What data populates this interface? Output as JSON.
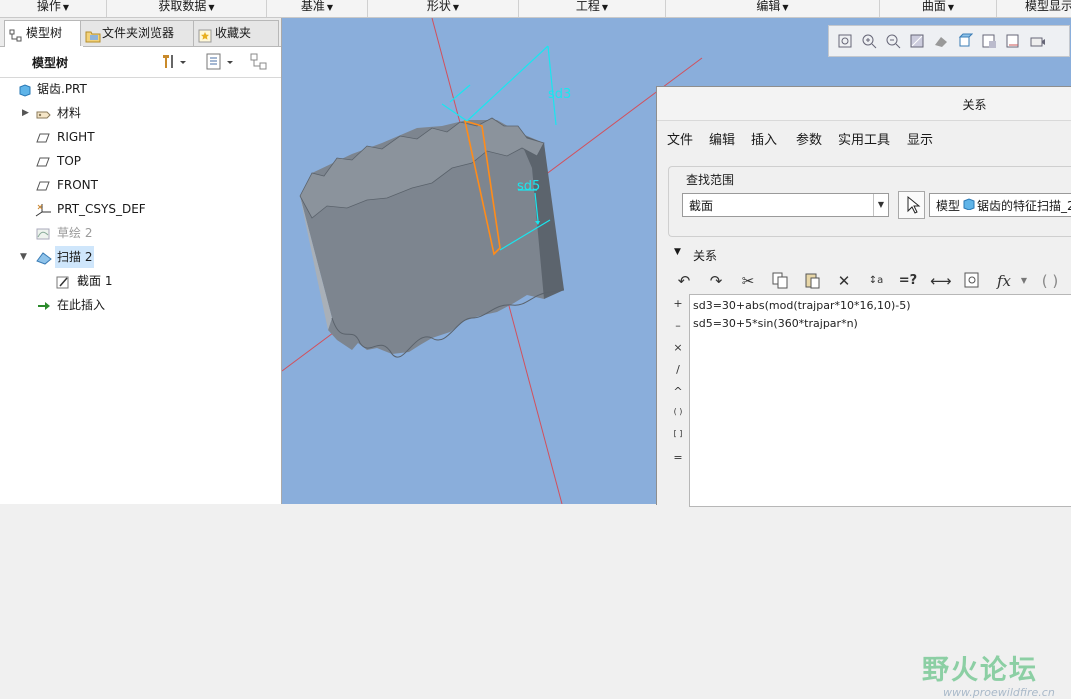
{
  "ribbon": {
    "groups": [
      "操作",
      "获取数据",
      "基准",
      "形状",
      "工程",
      "编辑",
      "曲面",
      "模型显示"
    ]
  },
  "left_panel": {
    "tabs": [
      "模型树",
      "文件夹浏览器",
      "收藏夹"
    ],
    "tree_title": "模型树",
    "items": [
      {
        "label": "锯齿.PRT",
        "icon": "part-icon"
      },
      {
        "label": "材料",
        "icon": "material-icon"
      },
      {
        "label": "RIGHT",
        "icon": "datum-plane-icon"
      },
      {
        "label": "TOP",
        "icon": "datum-plane-icon"
      },
      {
        "label": "FRONT",
        "icon": "datum-plane-icon"
      },
      {
        "label": "PRT_CSYS_DEF",
        "icon": "csys-icon"
      },
      {
        "label": "草绘 2",
        "icon": "sketch-icon"
      },
      {
        "label": "扫描 2",
        "icon": "sweep-icon"
      },
      {
        "label": "截面 1",
        "icon": "section-icon"
      },
      {
        "label": "在此插入",
        "icon": "insert-here-arrow-icon"
      }
    ]
  },
  "viewport": {
    "dimensions": [
      "sd3",
      "sd5"
    ]
  },
  "relations_dialog": {
    "title": "关系",
    "menu": [
      "文件",
      "编辑",
      "插入",
      "参数",
      "实用工具",
      "显示"
    ],
    "lookin_label": "查找范围",
    "lookin_value": "截面",
    "model_label": "模型",
    "model_value": "锯齿的特征扫描_2",
    "section_label": "关系",
    "operators": [
      "+",
      "–",
      "×",
      "/",
      "^",
      "( )",
      "[ ]",
      "="
    ],
    "relations": [
      "sd3=30+abs(mod(trajpar*10*16,10)-5)",
      "sd5=30+5*sin(360*trajpar*n)"
    ]
  },
  "watermark": {
    "title": "野火论坛",
    "url": "www.proewildfire.cn"
  },
  "colors": {
    "viewport_bg": "#8aaedb",
    "model_gray": "#7d858f",
    "dimension_cyan": "#19e6ef",
    "selection_orange": "#ff8c1a",
    "datum_red": "#d2505c"
  }
}
